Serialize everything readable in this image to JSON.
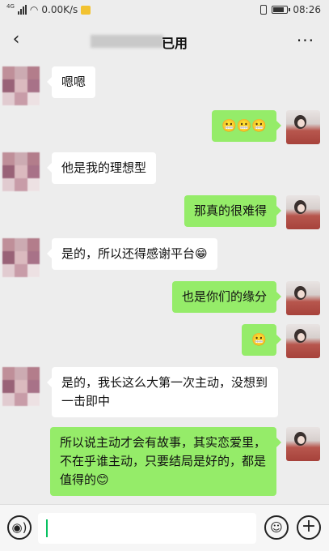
{
  "status_bar": {
    "network": "4G",
    "speed": "0.00K/s",
    "time": "08:26",
    "icons": [
      "signal-icon",
      "wifi-icon",
      "speed-app-icon",
      "vibrate-icon",
      "battery-icon"
    ]
  },
  "header": {
    "back_icon": "‹",
    "title": "已用",
    "more_icon": "···"
  },
  "messages": [
    {
      "side": "left",
      "text": "嗯嗯"
    },
    {
      "side": "right",
      "text": "😬😬😬"
    },
    {
      "side": "left",
      "text": "他是我的理想型"
    },
    {
      "side": "right",
      "text": "那真的很难得"
    },
    {
      "side": "left",
      "text": "是的，所以还得感谢平台😁"
    },
    {
      "side": "right",
      "text": "也是你们的缘分"
    },
    {
      "side": "right",
      "text": "😬"
    },
    {
      "side": "left",
      "text": "是的，我长这么大第一次主动，没想到一击即中"
    },
    {
      "side": "right",
      "text": "所以说主动才会有故事，其实恋爱里，不在乎谁主动，只要结局是好的，都是值得的😊"
    }
  ],
  "input_bar": {
    "voice_icon": "◉)",
    "emoji_icon": "☺",
    "plus_icon": "+",
    "input_value": ""
  },
  "colors": {
    "background": "#ededed",
    "sent_bubble": "#95ec69",
    "received_bubble": "#ffffff",
    "caret": "#07c160"
  }
}
